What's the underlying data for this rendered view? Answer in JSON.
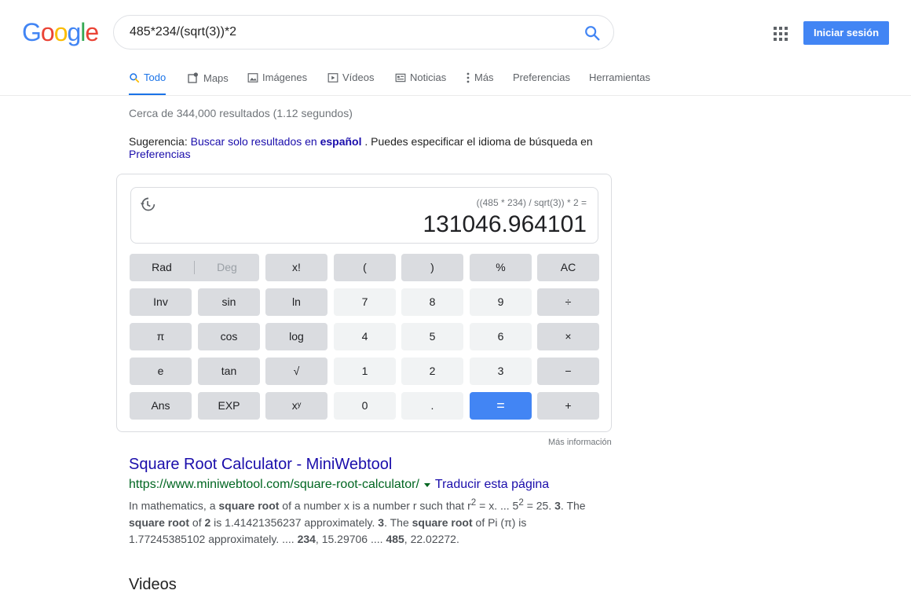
{
  "header": {
    "logo_letters": [
      {
        "ch": "G",
        "color": "#4285f4"
      },
      {
        "ch": "o",
        "color": "#ea4335"
      },
      {
        "ch": "o",
        "color": "#fbbc05"
      },
      {
        "ch": "g",
        "color": "#4285f4"
      },
      {
        "ch": "l",
        "color": "#34a853"
      },
      {
        "ch": "e",
        "color": "#ea4335"
      }
    ],
    "query": "485*234/(sqrt(3))*2",
    "signin_label": "Iniciar sesión"
  },
  "tabs": [
    {
      "label": "Todo",
      "icon": "search-icon",
      "active": true
    },
    {
      "label": "Maps",
      "icon": "map-pin-icon"
    },
    {
      "label": "Imágenes",
      "icon": "image-icon"
    },
    {
      "label": "Vídeos",
      "icon": "play-icon"
    },
    {
      "label": "Noticias",
      "icon": "news-icon"
    },
    {
      "label": "Más",
      "icon": "more-vert-icon"
    },
    {
      "label": "Preferencias"
    },
    {
      "label": "Herramientas"
    }
  ],
  "stats": "Cerca de 344,000 resultados (1.12 segundos)",
  "suggestion": {
    "prefix": "Sugerencia:",
    "link_text": "Buscar solo resultados en",
    "link_bold": "español",
    "middle": ". Puedes especificar el idioma de búsqueda en",
    "pref_link": "Preferencias"
  },
  "calculator": {
    "expression": "((485 * 234) / sqrt(3)) * 2 =",
    "result": "131046.964101",
    "rad_label": "Rad",
    "deg_label": "Deg",
    "keys": [
      [
        {
          "l": "x!",
          "t": "fn"
        },
        {
          "l": "(",
          "t": "fn"
        },
        {
          "l": ")",
          "t": "fn"
        },
        {
          "l": "%",
          "t": "fn"
        },
        {
          "l": "AC",
          "t": "fn"
        }
      ],
      [
        {
          "l": "Inv",
          "t": "fn"
        },
        {
          "l": "sin",
          "t": "fn"
        },
        {
          "l": "ln",
          "t": "fn"
        },
        {
          "l": "7",
          "t": "num"
        },
        {
          "l": "8",
          "t": "num"
        },
        {
          "l": "9",
          "t": "num"
        },
        {
          "l": "÷",
          "t": "fn"
        }
      ],
      [
        {
          "l": "π",
          "t": "fn"
        },
        {
          "l": "cos",
          "t": "fn"
        },
        {
          "l": "log",
          "t": "fn"
        },
        {
          "l": "4",
          "t": "num"
        },
        {
          "l": "5",
          "t": "num"
        },
        {
          "l": "6",
          "t": "num"
        },
        {
          "l": "×",
          "t": "fn"
        }
      ],
      [
        {
          "l": "e",
          "t": "fn"
        },
        {
          "l": "tan",
          "t": "fn"
        },
        {
          "l": "√",
          "t": "fn"
        },
        {
          "l": "1",
          "t": "num"
        },
        {
          "l": "2",
          "t": "num"
        },
        {
          "l": "3",
          "t": "num"
        },
        {
          "l": "−",
          "t": "fn"
        }
      ],
      [
        {
          "l": "Ans",
          "t": "fn"
        },
        {
          "l": "EXP",
          "t": "fn"
        },
        {
          "l": "xʸ",
          "t": "fn"
        },
        {
          "l": "0",
          "t": "num"
        },
        {
          "l": ".",
          "t": "num"
        },
        {
          "l": "=",
          "t": "eq"
        },
        {
          "l": "+",
          "t": "fn"
        }
      ]
    ],
    "more_info": "Más información"
  },
  "result": {
    "title": "Square Root Calculator - MiniWebtool",
    "url": "https://www.miniwebtool.com/square-root-calculator/",
    "translate": "Traducir esta página",
    "snippet_html": "In mathematics, a <b>square root</b> of a number x is a number r such that r<sup>2</sup> = x. ... 5<sup>2</sup> = 25. <b>3</b>. The <b>square root</b> of <b>2</b> is 1.41421356237 approximately. <b>3</b>. The <b>square root</b> of Pi (π) is 1.77245385102 approximately. .... <b>234</b>, 15.29706 .... <b>485</b>, 22.02272."
  },
  "videos_heading": "Videos"
}
